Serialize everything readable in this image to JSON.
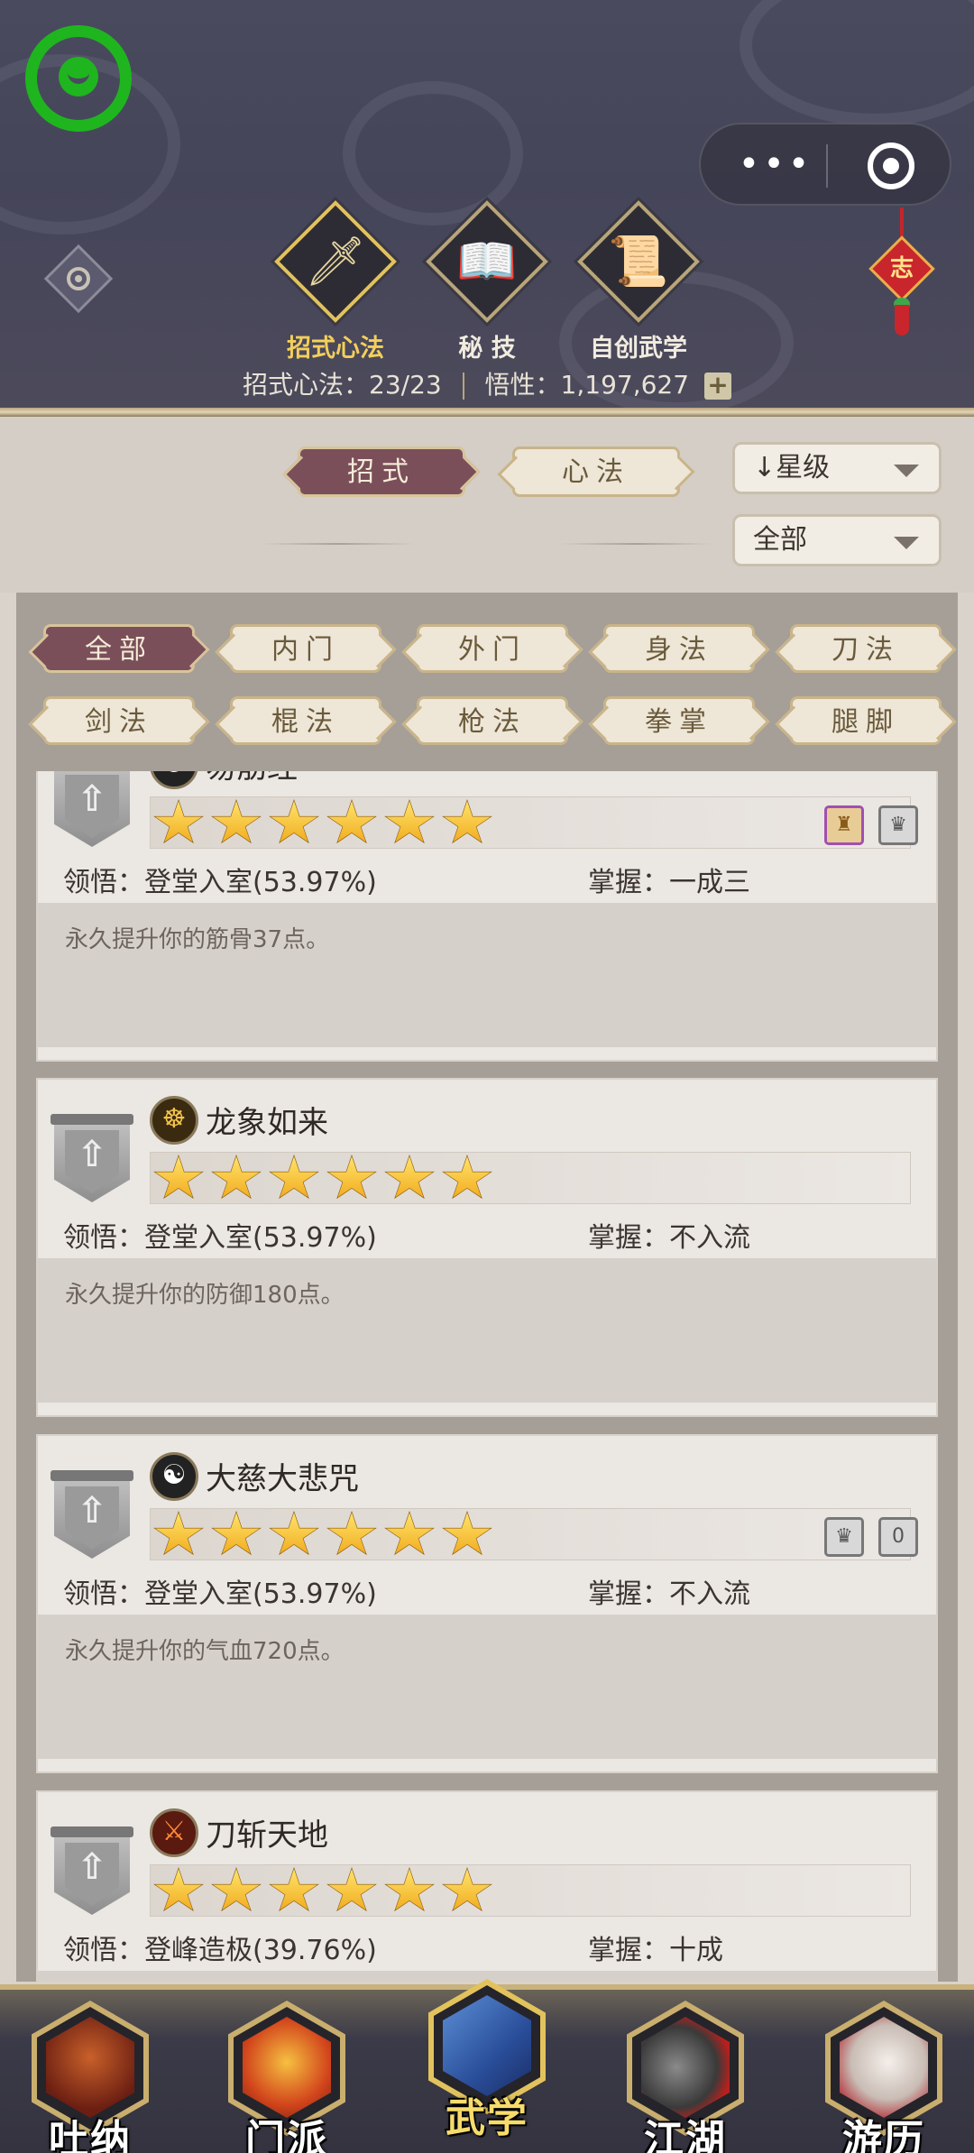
{
  "header": {
    "tabs": [
      {
        "label": "招式心法",
        "icon": "sword-icon",
        "active": true
      },
      {
        "label": "秘 技",
        "icon": "book-icon",
        "active": false
      },
      {
        "label": "自创武学",
        "icon": "scroll-icon",
        "active": false
      }
    ],
    "stats": {
      "moves_label": "招式心法：23/23",
      "insight_label": "悟性：1,197,627",
      "plus": "+"
    },
    "knot_char": "志",
    "capsule_dots": "•••"
  },
  "controls": {
    "type_tabs": [
      {
        "label": "招式",
        "active": true
      },
      {
        "label": "心法",
        "active": false
      }
    ],
    "sort_dropdown": "↓星级",
    "filter_dropdown": "全部"
  },
  "categories": [
    {
      "label": "全部",
      "active": true
    },
    {
      "label": "内门",
      "active": false
    },
    {
      "label": "外门",
      "active": false
    },
    {
      "label": "身法",
      "active": false
    },
    {
      "label": "刀法",
      "active": false
    },
    {
      "label": "剑法",
      "active": false
    },
    {
      "label": "棍法",
      "active": false
    },
    {
      "label": "枪法",
      "active": false
    },
    {
      "label": "拳掌",
      "active": false
    },
    {
      "label": "腿脚",
      "active": false
    }
  ],
  "skills": [
    {
      "name": "易筋经",
      "avatar": "yin-yang-icon",
      "stars": 6,
      "comprehension": "领悟：登堂入室(53.97%)",
      "mastery": "掌握：一成三",
      "description": "永久提升你的筋骨37点。",
      "badges": [
        "scroll-badge-icon",
        "equip-badge-icon"
      ]
    },
    {
      "name": "龙象如来",
      "avatar": "buddha-icon",
      "stars": 6,
      "comprehension": "领悟：登堂入室(53.97%)",
      "mastery": "掌握：不入流",
      "description": "永久提升你的防御180点。",
      "badges": []
    },
    {
      "name": "大慈大悲咒",
      "avatar": "yin-yang-icon",
      "stars": 6,
      "comprehension": "领悟：登堂入室(53.97%)",
      "mastery": "掌握：不入流",
      "description": "永久提升你的气血720点。",
      "badges": [
        "equip-badge-icon",
        "zero-badge-icon"
      ]
    },
    {
      "name": "刀斩天地",
      "avatar": "blade-icon",
      "stars": 6,
      "comprehension": "领悟：登峰造极(39.76%)",
      "mastery": "掌握：十成",
      "description": "",
      "badges": []
    }
  ],
  "bottom_nav": [
    {
      "label": "吐纳",
      "icon": "meditate-icon",
      "active": false
    },
    {
      "label": "门派",
      "icon": "banner-icon",
      "active": false
    },
    {
      "label": "武学",
      "icon": "martial-book-icon",
      "active": true
    },
    {
      "label": "江湖",
      "icon": "hat-icon",
      "active": false
    },
    {
      "label": "游历",
      "icon": "horse-icon",
      "active": false
    }
  ],
  "colors": {
    "header_bg": "#45455a",
    "active_tab_text": "#f3cf5b",
    "active_chip": "#7a4f5a",
    "star": "#f0a81a",
    "wechat_green": "#1fb51f"
  }
}
